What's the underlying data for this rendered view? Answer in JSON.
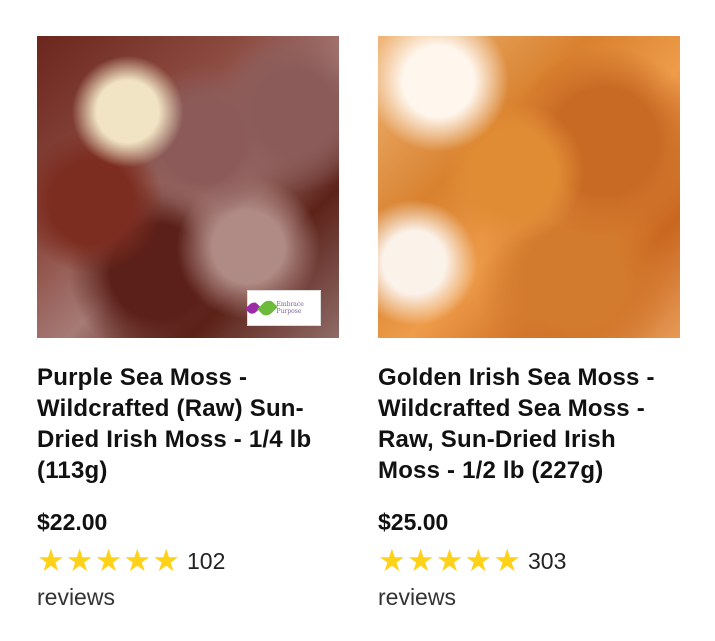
{
  "products": [
    {
      "title": "Purple Sea Moss - Wildcrafted (Raw) Sun-Dried Irish Moss - 1/4 lb (113g)",
      "price": "$22.00",
      "rating_count": "102",
      "rating_word": "reviews",
      "stars": 5,
      "badge_text": "Embrace Purpose"
    },
    {
      "title": "Golden Irish Sea Moss - Wildcrafted Sea Moss - Raw, Sun-Dried Irish Moss - 1/2 lb (227g)",
      "price": "$25.00",
      "rating_count": "303",
      "rating_word": "reviews",
      "stars": 5
    }
  ],
  "colors": {
    "star": "#ffd21a",
    "text": "#111111"
  },
  "icons": {
    "star": "star-icon"
  }
}
